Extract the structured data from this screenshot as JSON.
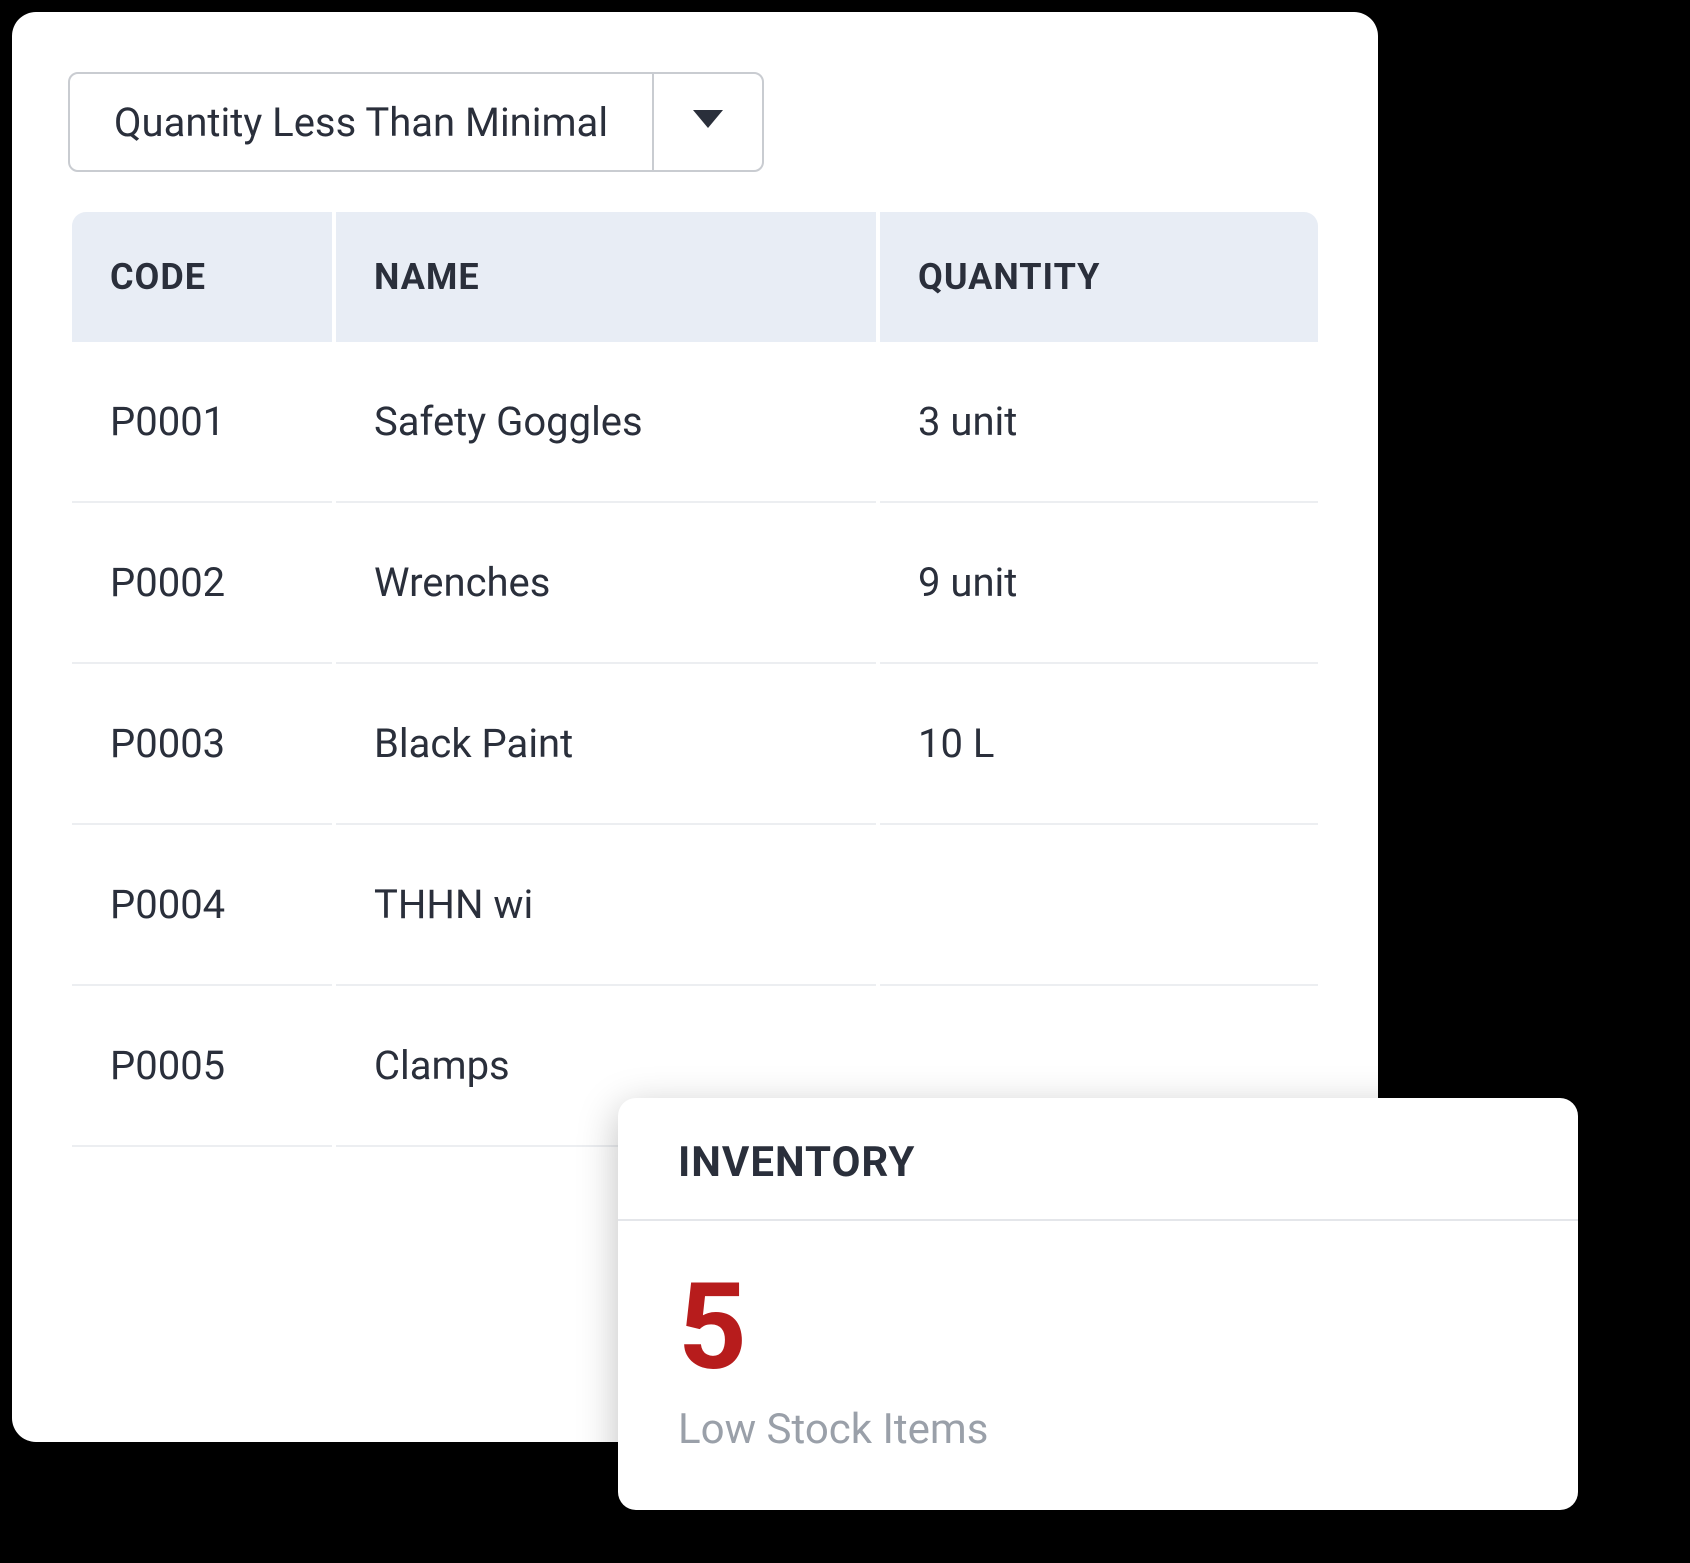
{
  "filter": {
    "selected_label": "Quantity Less Than Minimal"
  },
  "table": {
    "headers": {
      "code": "CODE",
      "name": "NAME",
      "quantity": "QUANTITY"
    },
    "rows": [
      {
        "code": "P0001",
        "name": "Safety Goggles",
        "quantity": "3 unit"
      },
      {
        "code": "P0002",
        "name": "Wrenches",
        "quantity": "9 unit"
      },
      {
        "code": "P0003",
        "name": "Black Paint",
        "quantity": "10 L"
      },
      {
        "code": "P0004",
        "name": "THHN wi",
        "quantity": ""
      },
      {
        "code": "P0005",
        "name": "Clamps",
        "quantity": ""
      }
    ]
  },
  "summary": {
    "title": "INVENTORY",
    "count": "5",
    "subtitle": "Low Stock Items"
  },
  "colors": {
    "accent_red": "#b71c1c",
    "text_dark": "#2a2f3b",
    "header_bg": "#e8edf5",
    "muted": "#9aa0a9"
  }
}
